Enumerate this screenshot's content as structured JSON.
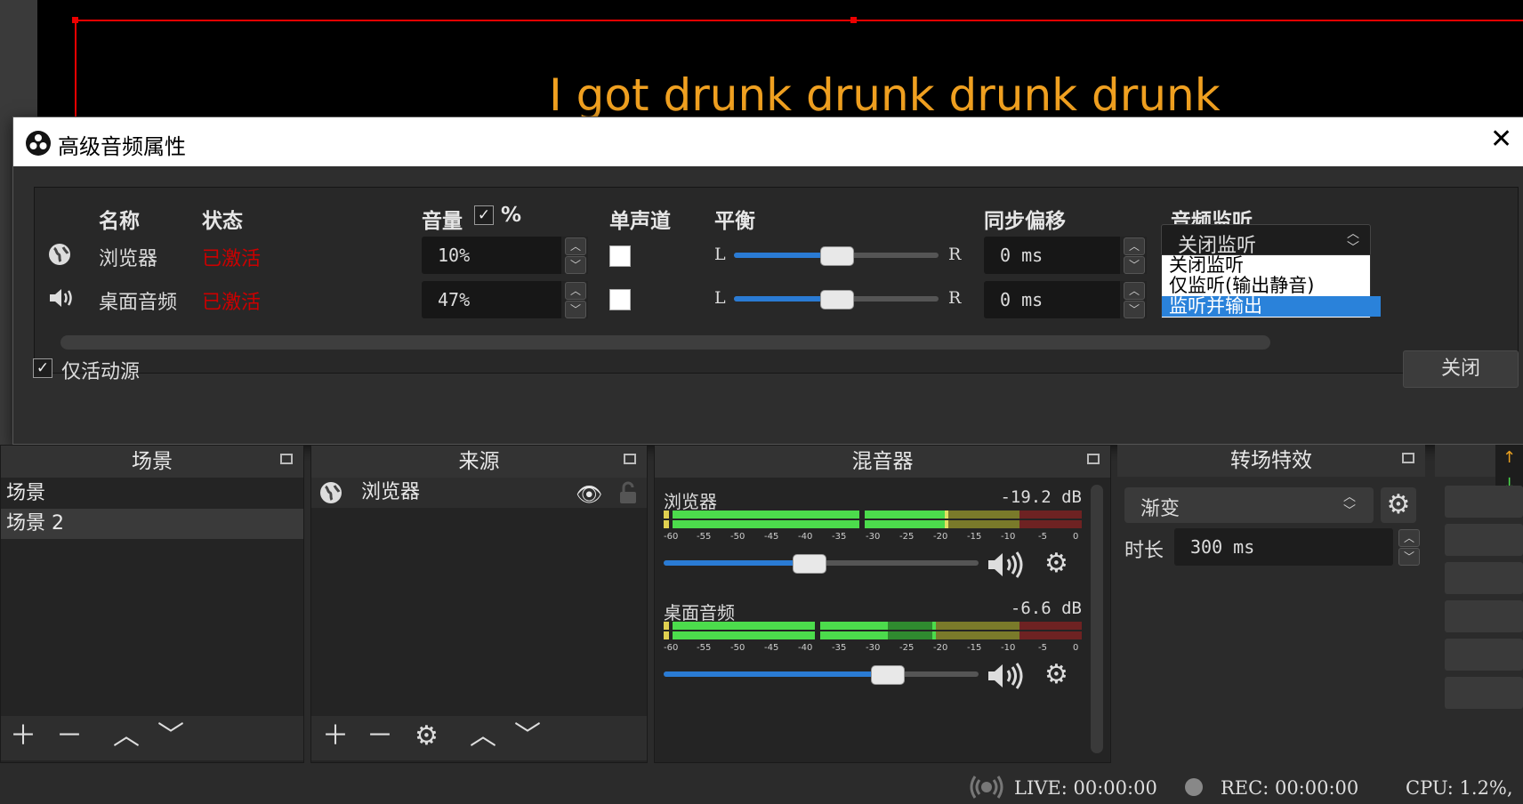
{
  "preview": {
    "text": "I got drunk drunk drunk drunk"
  },
  "dialog": {
    "title": "高级音频属性",
    "close_glyph": "✕",
    "headers": {
      "name": "名称",
      "status": "状态",
      "volume": "音量",
      "percent": "%",
      "mono": "单声道",
      "balance": "平衡",
      "sync_offset": "同步偏移",
      "monitoring": "音频监听"
    },
    "rows": [
      {
        "icon": "globe-icon",
        "name": "浏览器",
        "status": "已激活",
        "volume": "10%",
        "mono": false,
        "balance_left": "L",
        "balance_right": "R",
        "balance": 0.5,
        "sync": "0 ms",
        "monitoring": "关闭监听"
      },
      {
        "icon": "speaker-icon",
        "name": "桌面音频",
        "status": "已激活",
        "volume": "47%",
        "mono": false,
        "balance_left": "L",
        "balance_right": "R",
        "balance": 0.5,
        "sync": "0 ms",
        "monitoring": "关闭监听"
      }
    ],
    "monitoring_options": [
      "关闭监听",
      "仅监听(输出静音)",
      "监听并输出"
    ],
    "monitoring_selected": "监听并输出",
    "active_only_label": "仅活动源",
    "active_only_checked": true,
    "close_button": "关闭"
  },
  "scenes": {
    "title": "场景",
    "items": [
      "场景",
      "场景 2"
    ],
    "selected": "场景 2"
  },
  "sources": {
    "title": "来源",
    "items": [
      {
        "name": "浏览器",
        "icon": "globe-icon",
        "visible": true,
        "locked": false
      }
    ]
  },
  "mixer": {
    "title": "混音器",
    "channels": [
      {
        "name": "浏览器",
        "db": "-19.2 dB",
        "volume": 0.46
      },
      {
        "name": "桌面音频",
        "db": "-6.6 dB",
        "volume": 0.71
      }
    ],
    "ticks": [
      "-60",
      "-55",
      "-50",
      "-45",
      "-40",
      "-35",
      "-30",
      "-25",
      "-20",
      "-15",
      "-10",
      "-5",
      "0"
    ]
  },
  "transitions": {
    "title": "转场特效",
    "selected": "渐变",
    "duration_label": "时长",
    "duration_value": "300 ms"
  },
  "statusbar": {
    "live": "LIVE: 00:00:00",
    "rec": "REC: 00:00:00",
    "cpu": "CPU: 1.2%,"
  },
  "colors": {
    "accent": "#2a7bd4",
    "status_active": "#cc0000",
    "meter_green": "#4cdc4c",
    "meter_yellow": "#c8c84a",
    "meter_red": "#b83232"
  }
}
